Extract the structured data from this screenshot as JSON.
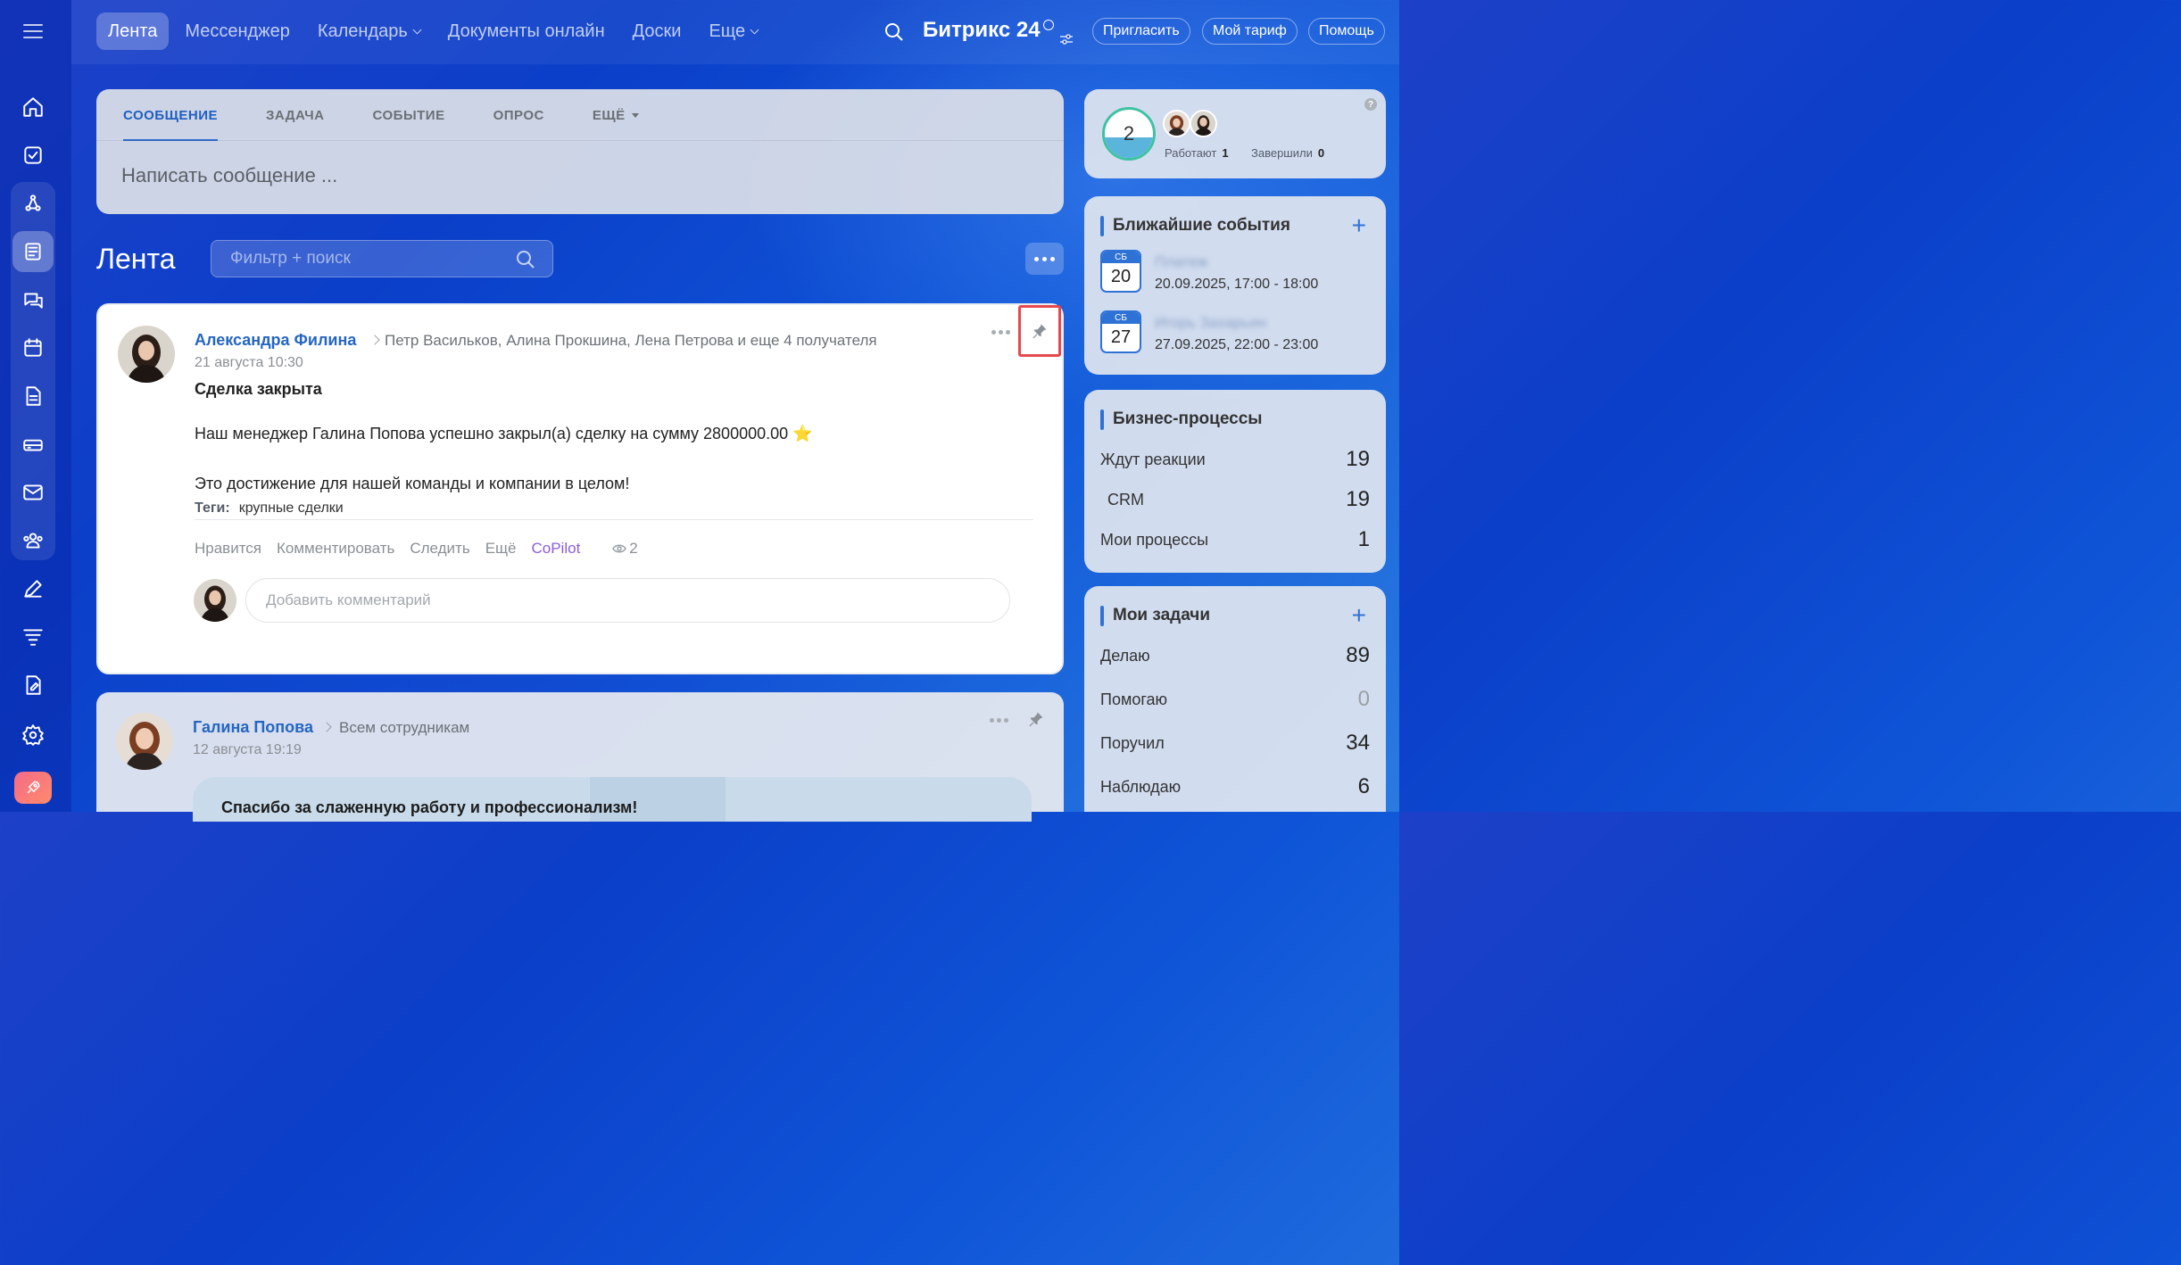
{
  "nav": {
    "items": [
      {
        "label": "Лента",
        "active": true,
        "chevron": false
      },
      {
        "label": "Мессенджер",
        "active": false,
        "chevron": false
      },
      {
        "label": "Календарь",
        "active": false,
        "chevron": true
      },
      {
        "label": "Документы онлайн",
        "active": false,
        "chevron": false
      },
      {
        "label": "Доски",
        "active": false,
        "chevron": false
      },
      {
        "label": "Еще",
        "active": false,
        "chevron": true
      }
    ],
    "brand": "Битрикс 24",
    "invite": "Пригласить",
    "tariff": "Мой тариф",
    "help": "Помощь"
  },
  "composer": {
    "tabs": [
      "СООБЩЕНИЕ",
      "ЗАДАЧА",
      "СОБЫТИЕ",
      "ОПРОС",
      "ЕЩЁ"
    ],
    "placeholder": "Написать сообщение ..."
  },
  "feed": {
    "title": "Лента",
    "filter_placeholder": "Фильтр + поиск"
  },
  "post": {
    "author": "Александра Филина",
    "recipients": "Петр Васильков, Алина Прокшина, Лена Петрова  и еще 4 получателя",
    "date": "21 августа 10:30",
    "title": "Сделка закрыта",
    "line1": "Наш менеджер Галина Попова успешно закрыл(а) сделку на сумму 2800000.00 ⭐",
    "line2": "Это достижение для нашей команды и компании в целом!",
    "tags_label": "Теги:",
    "tags_value": "крупные сделки",
    "actions": {
      "like": "Нравится",
      "comment": "Комментировать",
      "follow": "Следить",
      "more": "Ещё",
      "copilot": "CoPilot",
      "views": "2"
    },
    "comment_placeholder": "Добавить комментарий"
  },
  "post2": {
    "author": "Галина Попова",
    "recipients": "Всем сотрудникам",
    "date": "12 августа 19:19",
    "banner": "Спасибо за слаженную работу и профессионализм!"
  },
  "widgets": {
    "status": {
      "count": "2",
      "working_label": "Работают",
      "working": "1",
      "done_label": "Завершили",
      "done": "0",
      "help": "?"
    },
    "events": {
      "title": "Ближайшие события",
      "items": [
        {
          "day": "СБ",
          "num": "20",
          "name": "Платеж",
          "time": "20.09.2025, 17:00 - 18:00"
        },
        {
          "day": "СБ",
          "num": "27",
          "name": "Игорь Захарьин",
          "time": "27.09.2025, 22:00 - 23:00"
        }
      ]
    },
    "bp": {
      "title": "Бизнес-процессы",
      "rows": [
        {
          "label": "Ждут реакции",
          "value": "19"
        },
        {
          "label": "CRM",
          "value": "19"
        },
        {
          "label": "Мои процессы",
          "value": "1"
        }
      ]
    },
    "tasks": {
      "title": "Мои задачи",
      "rows": [
        {
          "label": "Делаю",
          "value": "89"
        },
        {
          "label": "Помогаю",
          "value": "0"
        },
        {
          "label": "Поручил",
          "value": "34"
        },
        {
          "label": "Наблюдаю",
          "value": "6"
        }
      ]
    }
  }
}
